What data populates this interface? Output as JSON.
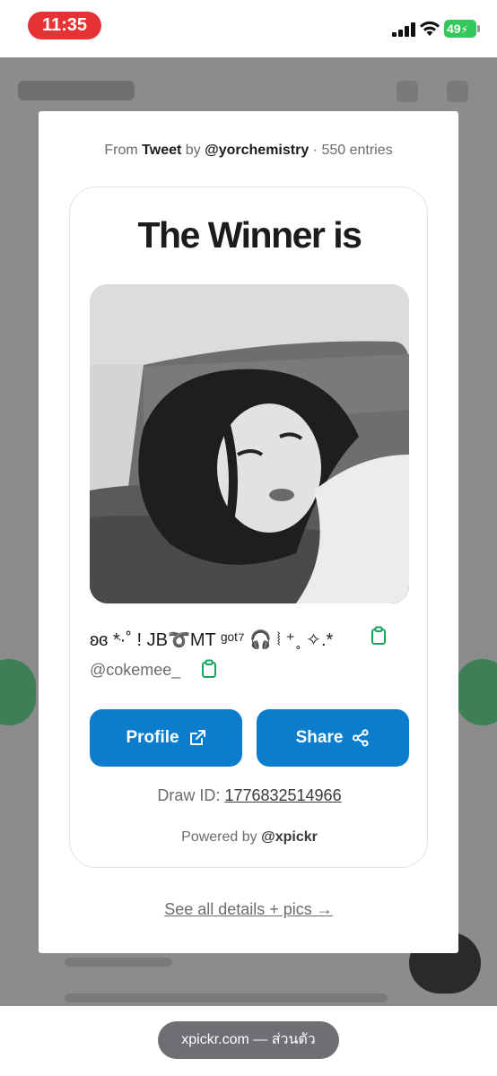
{
  "status_bar": {
    "time": "11:35",
    "battery": "49"
  },
  "modal": {
    "source": {
      "prefix": "From",
      "source_type": "Tweet",
      "by": "by",
      "author": "@yorchemistry",
      "separator": "·",
      "entries": "550 entries"
    },
    "card": {
      "title": "The Winner is",
      "winner_display_name": "ʚɞ *ּ·˚ ! JB➰MT ᵍᵒᵗ⁷ 🎧 ⦚ ⁺˳ ✧.*",
      "winner_handle": "@cokemee_",
      "profile_button": "Profile",
      "share_button": "Share",
      "draw_id_label": "Draw ID:",
      "draw_id_value": "1776832514966",
      "powered_by_label": "Powered by",
      "powered_by_name": "@xpickr"
    },
    "see_all_link": "See all details + pics →"
  },
  "url_bar": {
    "text": "xpickr.com — ส่วนตัว"
  },
  "colors": {
    "accent_blue": "#0b7dcc",
    "copy_green": "#1aa35a",
    "time_pill_red": "#e63235",
    "battery_green": "#34c759"
  },
  "icons": [
    "copy-icon",
    "external-link-icon",
    "share-icon",
    "signal-icon",
    "wifi-icon",
    "battery-icon"
  ]
}
